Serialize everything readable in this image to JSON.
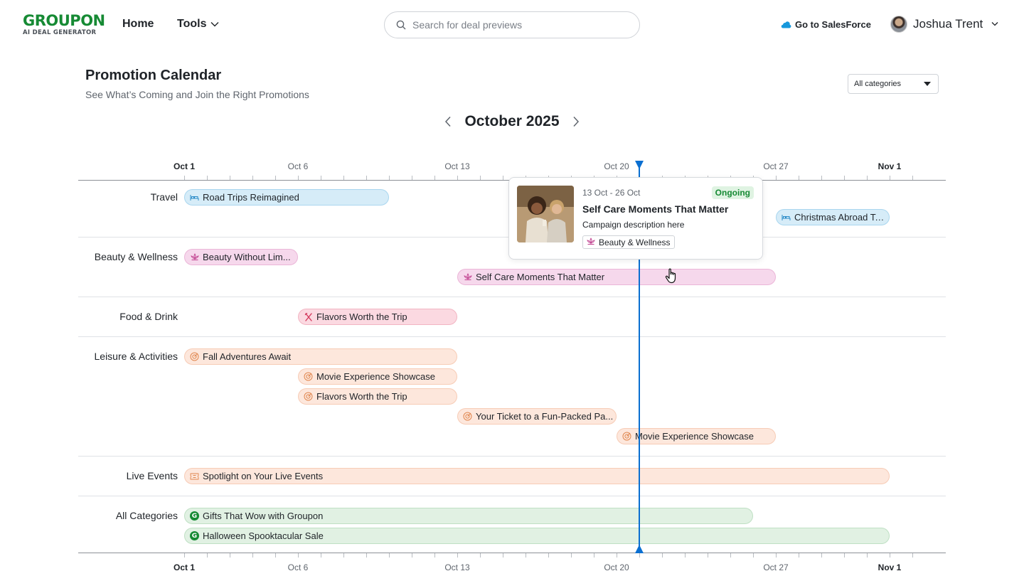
{
  "header": {
    "logo_main": "GROUPON",
    "logo_sub": "AI DEAL GENERATOR",
    "nav_home": "Home",
    "nav_tools": "Tools",
    "search_placeholder": "Search for deal previews",
    "salesforce_link": "Go to SalesForce",
    "user_name": "Joshua Trent"
  },
  "page": {
    "title": "Promotion Calendar",
    "subtitle": "See What’s Coming and Join the Right Promotions",
    "category_filter": "All categories"
  },
  "calendar": {
    "month": "October 2025",
    "axis_labels": [
      "Oct 1",
      "Oct 6",
      "Oct 13",
      "Oct 20",
      "Oct 27",
      "Nov 1"
    ],
    "today": "Oct 22",
    "rows": [
      {
        "name": "Travel",
        "category": "travel",
        "icon": "bed-icon",
        "bars": [
          {
            "label": "Road Trips Reimagined",
            "start": 1,
            "end": 10
          },
          {
            "label": "Christmas Abroad Take-Off",
            "start": 27,
            "end": 32
          }
        ]
      },
      {
        "name": "Beauty & Wellness",
        "category": "beauty",
        "icon": "lotus-icon",
        "bars": [
          {
            "label": "Beauty Without Lim...",
            "start": 1,
            "end": 6
          },
          {
            "label": "Self Care Moments That Matter",
            "start": 13,
            "end": 27
          }
        ]
      },
      {
        "name": "Food & Drink",
        "category": "food",
        "icon": "utensils-icon",
        "bars": [
          {
            "label": "Flavors Worth the Trip",
            "start": 6,
            "end": 13
          }
        ]
      },
      {
        "name": "Leisure & Activities",
        "category": "leisure",
        "icon": "activity-icon",
        "bars": [
          {
            "label": "Fall Adventures Await",
            "start": 1,
            "end": 13
          },
          {
            "label": "Movie Experience Showcase",
            "start": 6,
            "end": 13
          },
          {
            "label": "Flavors Worth the Trip",
            "start": 6,
            "end": 13
          },
          {
            "label": "Your Ticket to a Fun-Packed Pa...",
            "start": 13,
            "end": 20
          },
          {
            "label": "Movie Experience Showcase",
            "start": 20,
            "end": 27
          }
        ]
      },
      {
        "name": "Live Events",
        "category": "events",
        "icon": "ticket-icon",
        "bars": [
          {
            "label": "Spotlight on Your Live Events",
            "start": 1,
            "end": 32
          }
        ]
      },
      {
        "name": "All Categories",
        "category": "allcat",
        "icon": "groupon-g-icon",
        "bars": [
          {
            "label": "Gifts That Wow with Groupon",
            "start": 1,
            "end": 26
          },
          {
            "label": "Halloween Spooktacular Sale",
            "start": 1,
            "end": 32
          }
        ]
      }
    ]
  },
  "popover": {
    "dates": "13 Oct - 26 Oct",
    "status": "Ongoing",
    "title": "Self Care Moments That Matter",
    "description": "Campaign description here",
    "category": "Beauty & Wellness"
  },
  "colors": {
    "brand_green": "#168a34",
    "today_line": "#0a6fd1",
    "travel": "#d6ecf8",
    "beauty": "#f6d8ec",
    "food": "#fbd9e1",
    "leisure": "#fde7dc",
    "allcat": "#e1f1e3"
  }
}
